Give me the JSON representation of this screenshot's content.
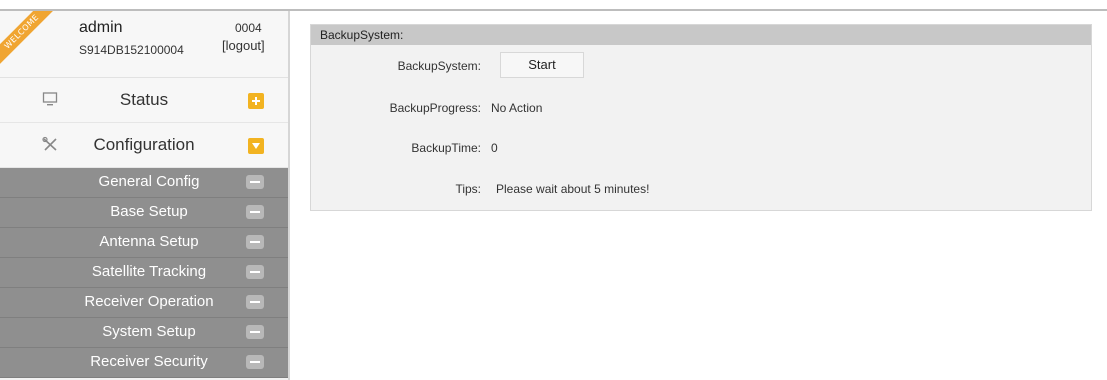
{
  "user": {
    "ribbon_text": "WELCOME",
    "name": "admin",
    "serial": "S914DB152100004",
    "id": "0004",
    "logout_label": "[logout]"
  },
  "menu": {
    "status": {
      "label": "Status",
      "icon": "monitor-icon",
      "toggle": "plus"
    },
    "configuration": {
      "label": "Configuration",
      "icon": "tools-icon",
      "toggle": "expanded"
    },
    "sub_items": [
      {
        "label": "General Config"
      },
      {
        "label": "Base Setup"
      },
      {
        "label": "Antenna Setup"
      },
      {
        "label": "Satellite Tracking"
      },
      {
        "label": "Receiver Operation"
      },
      {
        "label": "System Setup"
      },
      {
        "label": "Receiver Security"
      }
    ]
  },
  "panel": {
    "title": "BackupSystem:",
    "rows": {
      "backup_system_label": "BackupSystem:",
      "start_button": "Start",
      "progress_label": "BackupProgress:",
      "progress_value": "No Action",
      "time_label": "BackupTime:",
      "time_value": "0",
      "tips_label": "Tips:",
      "tips_value": "Please wait about 5 minutes!"
    }
  },
  "colors": {
    "accent": "#f2b321",
    "submenu_bg": "#8f8f8f",
    "panel_header": "#c8c8c8"
  }
}
